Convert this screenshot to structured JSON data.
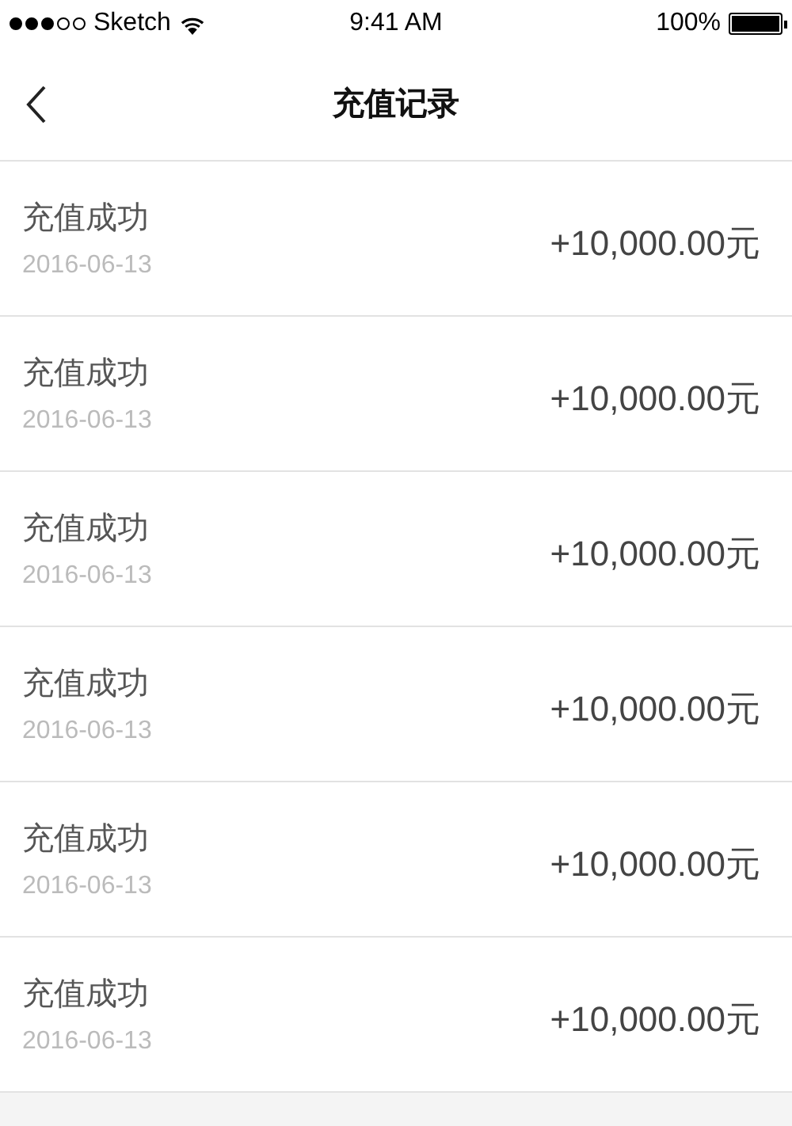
{
  "status_bar": {
    "signal_dots": [
      {
        "filled": true
      },
      {
        "filled": true
      },
      {
        "filled": true
      },
      {
        "filled": false
      },
      {
        "filled": false
      }
    ],
    "carrier": "Sketch",
    "time": "9:41 AM",
    "battery": "100%"
  },
  "nav": {
    "title": "充值记录"
  },
  "records": [
    {
      "title": "充值成功",
      "date": "2016-06-13",
      "amount": "+10,000.00元"
    },
    {
      "title": "充值成功",
      "date": "2016-06-13",
      "amount": "+10,000.00元"
    },
    {
      "title": "充值成功",
      "date": "2016-06-13",
      "amount": "+10,000.00元"
    },
    {
      "title": "充值成功",
      "date": "2016-06-13",
      "amount": "+10,000.00元"
    },
    {
      "title": "充值成功",
      "date": "2016-06-13",
      "amount": "+10,000.00元"
    },
    {
      "title": "充值成功",
      "date": "2016-06-13",
      "amount": "+10,000.00元"
    }
  ]
}
